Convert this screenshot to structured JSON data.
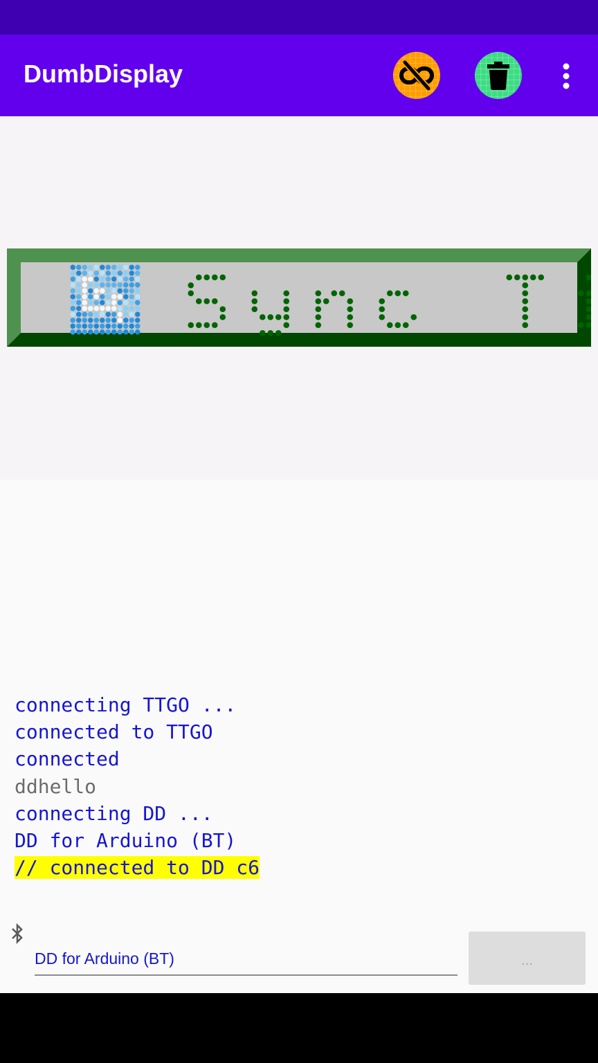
{
  "app_bar": {
    "title": "DumbDisplay",
    "unlink_icon": "link-off-icon",
    "trash_icon": "trash-icon",
    "menu_icon": "more-vert-icon",
    "colors": {
      "status_bar": "#3f00b1",
      "app_bar": "#6200ee",
      "unlink_button": "#ff9e00",
      "trash_button": "#3ddc84"
    }
  },
  "lcd": {
    "icon": "sync-clock-icon",
    "text": "Sync Time",
    "colors": {
      "frame_light": "#4f924f",
      "frame_dark": "#004800",
      "panel": "#c8c8c8",
      "dots": "#006400"
    }
  },
  "log": [
    {
      "text": "connecting TTGO ...",
      "style": "blue"
    },
    {
      "text": "connected to TTGO",
      "style": "blue"
    },
    {
      "text": "connected",
      "style": "blue"
    },
    {
      "text": "ddhello",
      "style": "gray"
    },
    {
      "text": "connecting DD ...",
      "style": "blue"
    },
    {
      "text": "DD for Arduino (BT)",
      "style": "blue"
    },
    {
      "text": "// connected to DD c6",
      "style": "highlight"
    }
  ],
  "footer": {
    "bt_icon": "bluetooth-icon",
    "device_name": "DD for Arduino (BT)",
    "more_button_label": "..."
  }
}
